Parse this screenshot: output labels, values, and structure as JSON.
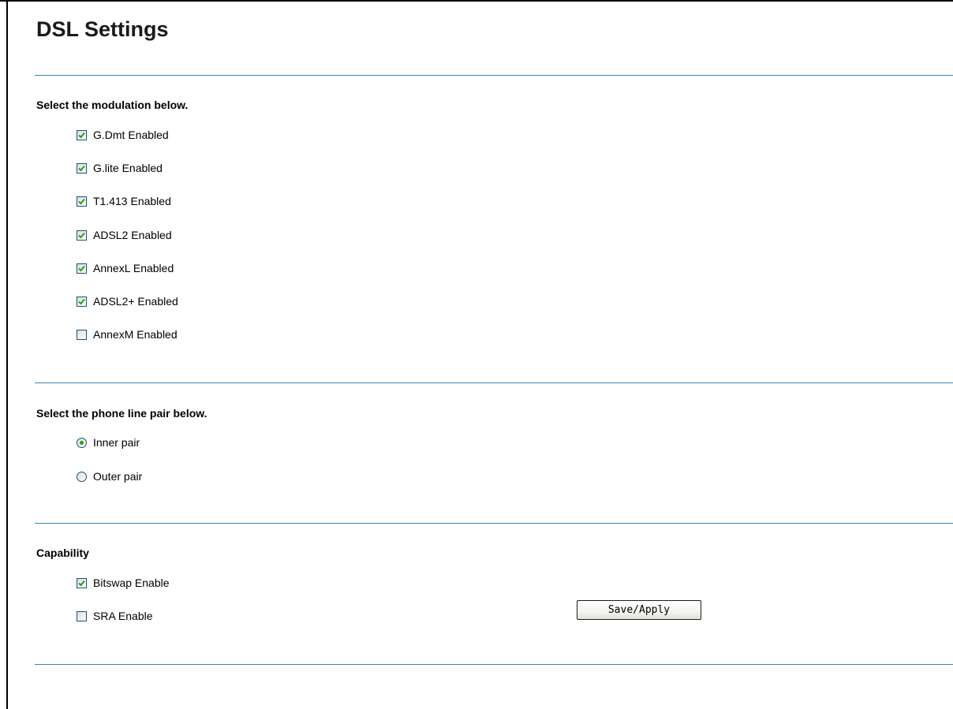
{
  "page": {
    "title": "DSL Settings"
  },
  "modulation": {
    "heading": "Select the modulation below.",
    "options": [
      {
        "label": "G.Dmt Enabled",
        "checked": true
      },
      {
        "label": "G.lite Enabled",
        "checked": true
      },
      {
        "label": "T1.413 Enabled",
        "checked": true
      },
      {
        "label": "ADSL2 Enabled",
        "checked": true
      },
      {
        "label": "AnnexL Enabled",
        "checked": true
      },
      {
        "label": "ADSL2+ Enabled",
        "checked": true
      },
      {
        "label": "AnnexM Enabled",
        "checked": false
      }
    ]
  },
  "phone_line": {
    "heading": "Select the phone line pair below.",
    "options": [
      {
        "label": "Inner pair",
        "selected": true
      },
      {
        "label": "Outer pair",
        "selected": false
      }
    ]
  },
  "capability": {
    "heading": "Capability",
    "options": [
      {
        "label": "Bitswap Enable",
        "checked": true
      },
      {
        "label": "SRA Enable",
        "checked": false
      }
    ]
  },
  "actions": {
    "save_label": "Save/Apply"
  },
  "colors": {
    "divider": "#3b84b8",
    "checkbox_border": "#1c5180",
    "check_mark": "#21a121"
  }
}
